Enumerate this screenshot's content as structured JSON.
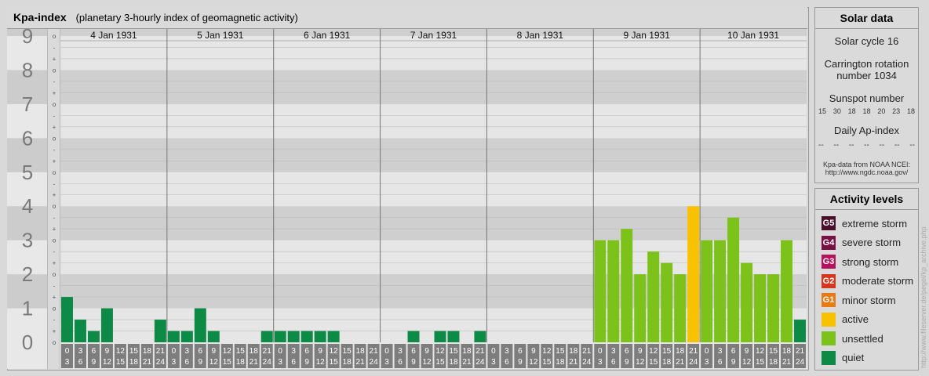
{
  "title": "Kpa-index",
  "subtitle": "(planetary 3-hourly index of geomagnetic activity)",
  "solar": {
    "header": "Solar data",
    "cycle": "Solar cycle 16",
    "carrington_line1": "Carrington rotation",
    "carrington_line2": "number 1034",
    "sunspot_label": "Sunspot number",
    "sunspot_values": [
      "15",
      "30",
      "18",
      "18",
      "20",
      "23",
      "18"
    ],
    "ap_label": "Daily Ap-index",
    "ap_values": [
      "--",
      "--",
      "--",
      "--",
      "--",
      "--",
      "--"
    ],
    "source_line1": "Kpa-data from NOAA NCEI:",
    "source_line2": "http://www.ngdc.noaa.gov/"
  },
  "levels": {
    "header": "Activity levels",
    "items": [
      {
        "badge": "G5",
        "label": "extreme storm",
        "color": "#4a0f2a"
      },
      {
        "badge": "G4",
        "label": "severe storm",
        "color": "#7a0f46"
      },
      {
        "badge": "G3",
        "label": "strong storm",
        "color": "#b5125e"
      },
      {
        "badge": "G2",
        "label": "moderate storm",
        "color": "#d6361e"
      },
      {
        "badge": "G1",
        "label": "minor storm",
        "color": "#e87a14"
      },
      {
        "badge": "",
        "label": "active",
        "color": "#f8c200"
      },
      {
        "badge": "",
        "label": "unsettled",
        "color": "#7dc11b"
      },
      {
        "badge": "",
        "label": "quiet",
        "color": "#0e8a47"
      }
    ]
  },
  "watermark": "http://www.fileserver.de/pegel/kp_archive.php",
  "chart_data": {
    "type": "bar",
    "ylim": [
      0,
      9
    ],
    "y_ticks": [
      "0",
      "1",
      "2",
      "3",
      "4",
      "5",
      "6",
      "7",
      "8",
      "9"
    ],
    "minor_labels": [
      "o",
      "+",
      "-"
    ],
    "days": [
      "4 Jan 1931",
      "5 Jan 1931",
      "6 Jan 1931",
      "7 Jan 1931",
      "8 Jan 1931",
      "9 Jan 1931",
      "10 Jan 1931"
    ],
    "interval_start": [
      "0",
      "3",
      "6",
      "9",
      "12",
      "15",
      "18",
      "21"
    ],
    "interval_end": [
      "3",
      "6",
      "9",
      "12",
      "15",
      "18",
      "21",
      "24"
    ],
    "colors": {
      "quiet": "#0e8a47",
      "unsettled": "#7dc11b",
      "active": "#f8c200"
    },
    "values": [
      1.333,
      0.667,
      0.333,
      1.0,
      0,
      0,
      0,
      0.667,
      0.333,
      0.333,
      1.0,
      0.333,
      0,
      0,
      0,
      0.333,
      0.333,
      0.333,
      0.333,
      0.333,
      0.333,
      0,
      0,
      0,
      0,
      0,
      0.333,
      0,
      0.333,
      0.333,
      0,
      0.333,
      0,
      0,
      0,
      0,
      0,
      0,
      0,
      0,
      3.0,
      3.0,
      3.333,
      2.0,
      2.667,
      2.333,
      2.0,
      4.0,
      3.0,
      3.0,
      3.667,
      2.333,
      2.0,
      2.0,
      3.0,
      0.667
    ]
  }
}
